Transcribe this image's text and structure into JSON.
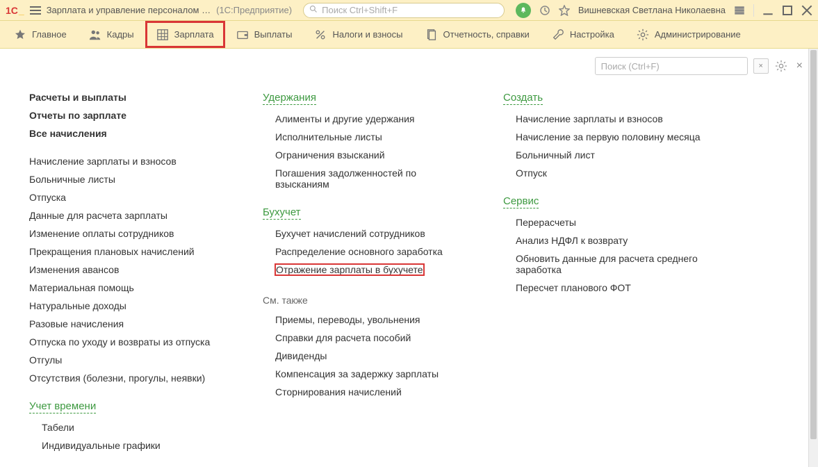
{
  "titlebar": {
    "app_title": "Зарплата и управление персоналом …",
    "platform": "(1С:Предприятие)",
    "search_placeholder": "Поиск Ctrl+Shift+F",
    "user": "Вишневская Светлана Николаевна"
  },
  "menubar": {
    "items": [
      {
        "label": "Главное",
        "icon": "star"
      },
      {
        "label": "Кадры",
        "icon": "people"
      },
      {
        "label": "Зарплата",
        "icon": "grid",
        "active": true
      },
      {
        "label": "Выплаты",
        "icon": "wallet"
      },
      {
        "label": "Налоги и взносы",
        "icon": "percent"
      },
      {
        "label": "Отчетность, справки",
        "icon": "docs"
      },
      {
        "label": "Настройка",
        "icon": "wrench"
      },
      {
        "label": "Администрирование",
        "icon": "gear"
      }
    ]
  },
  "panel": {
    "search_placeholder": "Поиск (Ctrl+F)",
    "clear_label": "×"
  },
  "col1": {
    "top_links": [
      "Расчеты и выплаты",
      "Отчеты по зарплате",
      "Все начисления"
    ],
    "links": [
      "Начисление зарплаты и взносов",
      "Больничные листы",
      "Отпуска",
      "Данные для расчета зарплаты",
      "Изменение оплаты сотрудников",
      "Прекращения плановых начислений",
      "Изменения авансов",
      "Материальная помощь",
      "Натуральные доходы",
      "Разовые начисления",
      "Отпуска по уходу и возвраты из отпуска",
      "Отгулы",
      "Отсутствия (болезни, прогулы, неявки)"
    ],
    "section2_header": "Учет времени",
    "section2_links": [
      "Табели",
      "Индивидуальные графики"
    ]
  },
  "col2": {
    "header1": "Удержания",
    "links1": [
      "Алименты и другие удержания",
      "Исполнительные листы",
      "Ограничения взысканий",
      "Погашения задолженностей по взысканиям"
    ],
    "header2": "Бухучет",
    "links2": [
      "Бухучет начислений сотрудников",
      "Распределение основного заработка",
      "Отражение зарплаты в бухучете"
    ],
    "header3": "См. также",
    "links3": [
      "Приемы, переводы, увольнения",
      "Справки для расчета пособий",
      "Дивиденды",
      "Компенсация за задержку зарплаты",
      "Сторнирования начислений"
    ]
  },
  "col3": {
    "header1": "Создать",
    "links1": [
      "Начисление зарплаты и взносов",
      "Начисление за первую половину месяца",
      "Больничный лист",
      "Отпуск"
    ],
    "header2": "Сервис",
    "links2": [
      "Перерасчеты",
      "Анализ НДФЛ к возврату",
      "Обновить данные для расчета среднего заработка",
      "Пересчет планового ФОТ"
    ]
  }
}
